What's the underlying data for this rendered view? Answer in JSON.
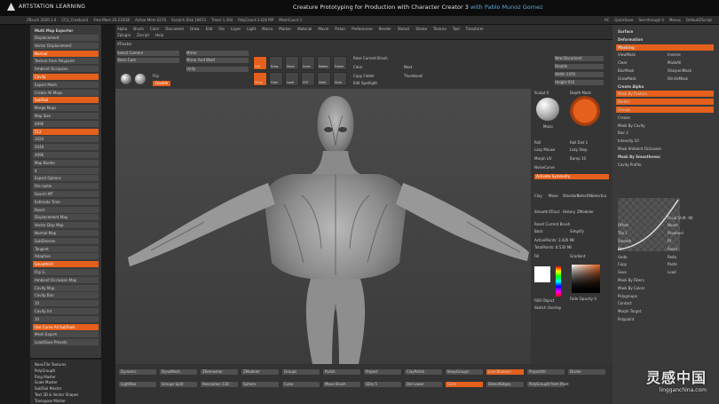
{
  "header": {
    "brand": "ARTSTATION LEARNING",
    "title_main": "Creature Prototyping for Production with Character Creator 3",
    "title_with": "with",
    "author": "Pablo Munoz Gomez"
  },
  "zbar": {
    "items": [
      "ZBrush 2020.1.4",
      "CC3_Creature3",
      "Free Mem 16.235GB",
      "Active Mem 6270",
      "Scratch Disk 18672",
      "Timer 1.304",
      "PolyCount 3.426 MP",
      "MeshCount 1"
    ],
    "right": [
      "AC",
      "QuickSave",
      "See-through 0",
      "Menus",
      "DefaultZScript"
    ]
  },
  "menubar": {
    "row1": [
      "Alpha",
      "Brush",
      "Color",
      "Document",
      "Draw",
      "Edit",
      "File",
      "Layer",
      "Light",
      "Macro",
      "Marker",
      "Material",
      "Movie",
      "Picker",
      "Preferences",
      "Render",
      "Stencil",
      "Stroke",
      "Texture",
      "Tool",
      "Transform"
    ],
    "row2": [
      "Zplugin",
      "Zscript",
      "Help"
    ],
    "tool": "XTractor"
  },
  "left_panel": {
    "header": "Multi Map Exporter",
    "items": [
      "Displacement",
      "Vector Displacement",
      "Normal",
      "Texture from Polypaint",
      "Ambient Occlusion",
      "Cavity",
      "Export Mesh",
      "Create All Maps",
      "SubTool",
      "Merge Maps",
      "Map Size",
      "4096",
      "512",
      "1024",
      "2048",
      "4096",
      "Map Border",
      "4",
      "Export Options",
      "File name",
      "Search MT",
      "Estimate Time",
      "Reset",
      "Displacement Map",
      "Vector Disp Map",
      "Normal Map",
      "SubDivision",
      "Tangent",
      "Adaptive",
      "SmoothUV",
      "Flip G",
      "Ambient Occlusion Map",
      "Cavity Map",
      "Cavity Blur",
      "10",
      "Cavity Int",
      "10",
      "Use Curve All SubTools",
      "Mesh Export",
      "Load/Save Presets"
    ],
    "bottom": [
      "NanoTile Textures",
      "PolyGroupIt",
      "Ring Master",
      "Scale Master",
      "SubTool Master",
      "Text 3D & Vector Shapes",
      "Transpose Master"
    ]
  },
  "toolbar": {
    "select_camera": "Select Camera",
    "store_cam": "Store Cam",
    "mirror": "Mirror",
    "mirror_weld": "Mirror And Weld",
    "unify": "Unify",
    "flip": "Flip",
    "double": "Double",
    "brush": "Rose Current Brush",
    "clear": "Clear",
    "next": "Next",
    "copy_folder": "Copy Folder",
    "edit_spotlight": "Edit Spotlight",
    "thumbnail": "Thumbnail",
    "new_document": "New Document",
    "double2": "Double",
    "width": "Width 1470",
    "height": "Height 910",
    "modes": [
      "Edit",
      "Draw",
      "Move",
      "Scale",
      "Rotate",
      "Frame",
      "Persp",
      "Floor",
      "Local",
      "XYZ",
      "Zadd",
      "Zsub"
    ]
  },
  "right_mid": {
    "items": [
      "Sculpt 0",
      "Mono",
      "Depth Mask",
      "Roll",
      "Roll Dist 1",
      "Lazy Mouse",
      "Lazy Step",
      "Morph UV",
      "Bump 10",
      "NoiseCurve",
      "Activate Symmetry",
      "Clay",
      "Move",
      "Standard",
      "SelectRe",
      "SelectLa",
      "Smooth",
      "XTract",
      "History",
      "ZModeler",
      "Reset Current Brush",
      "Back",
      "Simplify",
      "ActivePoints: 3.426 Mil",
      "TotalPoints: 8.530 Mil",
      "Fill",
      "Gradient",
      "Fade Opacity 0",
      "FBO Object",
      "Sketch Overlay"
    ]
  },
  "right_panel": {
    "items": [
      "Surface",
      "Deformation",
      "Masking",
      "ViewMask",
      "Inverse",
      "Clear",
      "MaskAll",
      "BlurMask",
      "SharpenMask",
      "GrowMask",
      "ShrinkMask",
      "Create Alpha",
      "Mask By Feature",
      "Border",
      "Groups",
      "Crease",
      "Mask By Cavity",
      "Blur 2",
      "Intensity 10",
      "Mask Ambient Occlusion",
      "Mask By Smoothness",
      "Cavity Profile",
      "Focal Shift -90",
      "Offset",
      "Nonm",
      "Tile 1",
      "Pinwheel",
      "Smooth",
      "Rf",
      "Rf",
      "Reset",
      "Undo",
      "Redo",
      "Copy",
      "Paste",
      "Save",
      "Load",
      "Mask By Fibers",
      "Mask By Colors",
      "Polygroups",
      "Contact",
      "Morph Target",
      "Polypaint"
    ]
  },
  "bottom_toolbar": {
    "items": [
      "Dynamic",
      "DynaMesh",
      "ZRemesher",
      "ZModeler",
      "Groups",
      "Polish",
      "Project",
      "ClayPolish",
      "KeepGroups",
      "Live Boolean",
      "ProjectAll",
      "Divide",
      "LightBox",
      "Groups Split",
      "Resolution 128",
      "Sphere",
      "Cube",
      "Move Brush",
      "SDiv 5",
      "Del Lower",
      "Color",
      "DetectEdges",
      "PolyGroupIt from Paint"
    ]
  },
  "watermark": {
    "cn": "灵感中国",
    "en": "lingganchina.com"
  },
  "colors": {
    "accent": "#e4601c",
    "panel": "#3a3a3a",
    "viewport": "#454545"
  }
}
